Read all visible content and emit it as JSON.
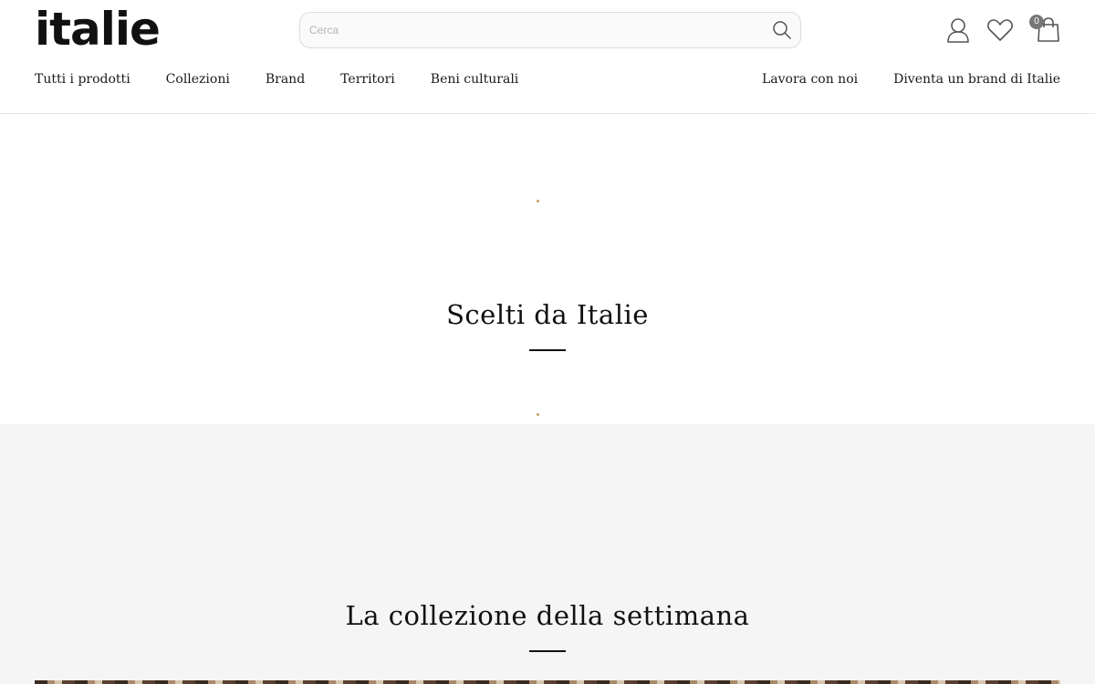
{
  "header": {
    "logo": "italie",
    "search": {
      "placeholder": "Cerca"
    },
    "cart_count": "0",
    "nav_left": [
      "Tutti i prodotti",
      "Collezioni",
      "Brand",
      "Territori",
      "Beni culturali"
    ],
    "nav_right": [
      "Lavora con noi",
      "Diventa un brand di Italie"
    ]
  },
  "sections": {
    "picked_title": "Scelti da Italie",
    "collection_title": "La collezione della settimana"
  },
  "colors": {
    "accent_dot": "#c9a062",
    "grey_band": "#f5f5f5",
    "badge": "#777777"
  },
  "icons": [
    "search-icon",
    "user-icon",
    "heart-icon",
    "cart-icon"
  ]
}
